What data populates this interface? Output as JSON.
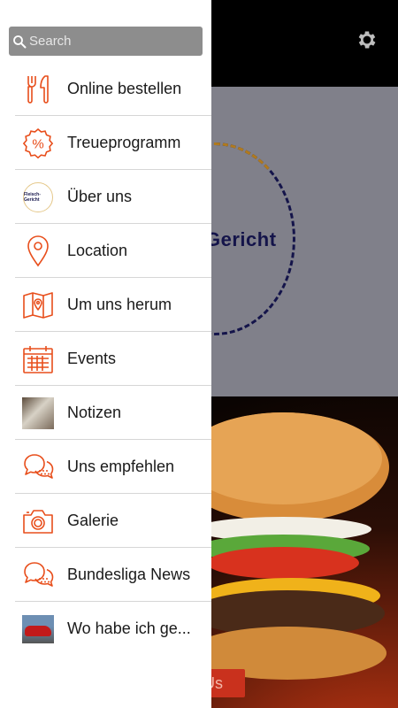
{
  "app": {
    "background_logo_text": "Gericht",
    "background_action_label": "Us",
    "accent_color": "#e84e1b"
  },
  "search": {
    "placeholder": "Search",
    "value": ""
  },
  "menu": {
    "items": [
      {
        "label": "Online bestellen",
        "icon": "fork-knife-icon"
      },
      {
        "label": "Treueprogramm",
        "icon": "percent-badge-icon"
      },
      {
        "label": "Über uns",
        "icon": "restaurant-logo-thumbnail",
        "logo_text": "Fleisch-Gericht"
      },
      {
        "label": "Location",
        "icon": "map-pin-icon"
      },
      {
        "label": "Um uns herum",
        "icon": "map-icon"
      },
      {
        "label": "Events",
        "icon": "calendar-icon"
      },
      {
        "label": "Notizen",
        "icon": "notes-photo-thumbnail"
      },
      {
        "label": "Uns empfehlen",
        "icon": "chat-bubbles-icon"
      },
      {
        "label": "Galerie",
        "icon": "camera-icon"
      },
      {
        "label": "Bundesliga News",
        "icon": "chat-bubbles-icon"
      },
      {
        "label": "Wo habe ich ge...",
        "icon": "car-photo-thumbnail"
      }
    ]
  }
}
